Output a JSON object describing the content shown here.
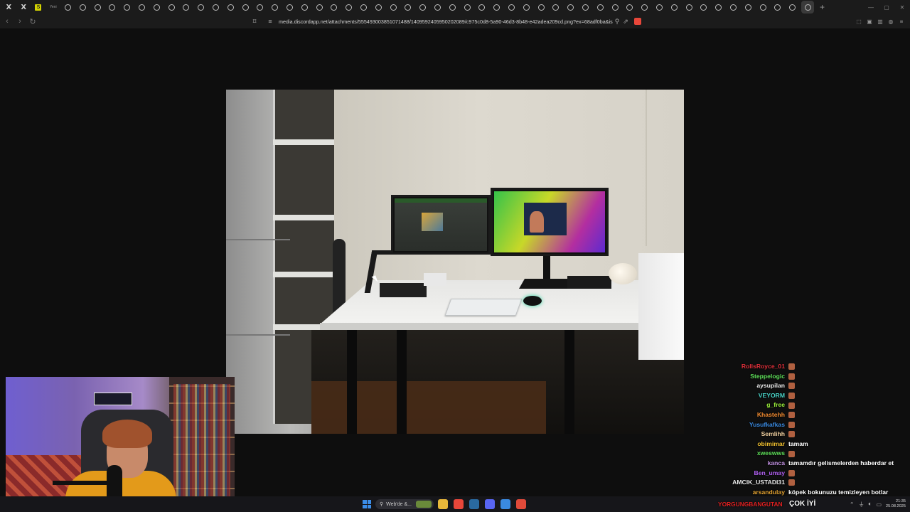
{
  "browser": {
    "tabs": [
      {
        "icon": "x-icon",
        "label": "X"
      },
      {
        "icon": "x-icon",
        "label": "X"
      },
      {
        "icon": "s-icon",
        "label": "S"
      },
      {
        "icon": "text-icon",
        "label": "Yeni"
      }
    ],
    "generic_tab_count": 51,
    "url": "media.discordapp.net/attachments/555493003851071488/1409592405950202089/c975c0d8-5a90-46d3-8b48-e42adea209cd.png?ex=68adf0ba&is=..."
  },
  "photo": {
    "description_colors": {
      "wall": "#d6d2c8",
      "desk": "#eeeeec",
      "monitor_right": "#c8d828"
    }
  },
  "chat": {
    "messages": [
      {
        "name": "RollsRoyce_01",
        "color": "#e0303a",
        "msg": "",
        "emote": true
      },
      {
        "name": "Steppelogic",
        "color": "#5fe05a",
        "msg": "",
        "emote": true
      },
      {
        "name": "aysupilan",
        "color": "#e8e8e8",
        "msg": "",
        "emote": true
      },
      {
        "name": "VEYORM",
        "color": "#4ad4c8",
        "msg": "",
        "emote": true
      },
      {
        "name": "g_free",
        "color": "#9aef3a",
        "msg": "",
        "emote": true
      },
      {
        "name": "Khastehh",
        "color": "#f08a30",
        "msg": "",
        "emote": true
      },
      {
        "name": "Yusufkafkas",
        "color": "#3a8ae0",
        "msg": "",
        "emote": true
      },
      {
        "name": "Semlihh",
        "color": "#f0d0a0",
        "msg": "",
        "emote": true
      },
      {
        "name": "obimimar",
        "color": "#f0c030",
        "msg": "tamam",
        "emote": false
      },
      {
        "name": "xweswws",
        "color": "#5fe05a",
        "msg": "",
        "emote": true
      },
      {
        "name": "kanca",
        "color": "#c090e0",
        "msg": "tamamdır gelismelerden haberdar et",
        "emote": false
      },
      {
        "name": "Ben_umay",
        "color": "#b060f0",
        "msg": "",
        "emote": true
      },
      {
        "name": "AMCIK_USTADI31",
        "color": "#e8e8e8",
        "msg": "",
        "emote": true
      },
      {
        "name": "arsandulay",
        "color": "#e0a030",
        "msg": "köpek bokunuzu temizleyen botlar",
        "emote": false
      }
    ],
    "last": {
      "name": "YORGUNGBANGUTAN",
      "msg": "ÇOK İYİ"
    }
  },
  "taskbar": {
    "search_text": "Web'de &...",
    "clock_time": "21:35",
    "clock_date": "25.08.2025",
    "apps": [
      {
        "name": "file-explorer-icon",
        "color": "#e8b83a"
      },
      {
        "name": "brave-icon",
        "color": "#e8473a"
      },
      {
        "name": "steam-icon",
        "color": "#2a6aa0"
      },
      {
        "name": "discord-icon",
        "color": "#5865f2"
      },
      {
        "name": "app-icon",
        "color": "#3a8ae0"
      },
      {
        "name": "chrome-icon",
        "color": "#e04a3a"
      }
    ]
  }
}
